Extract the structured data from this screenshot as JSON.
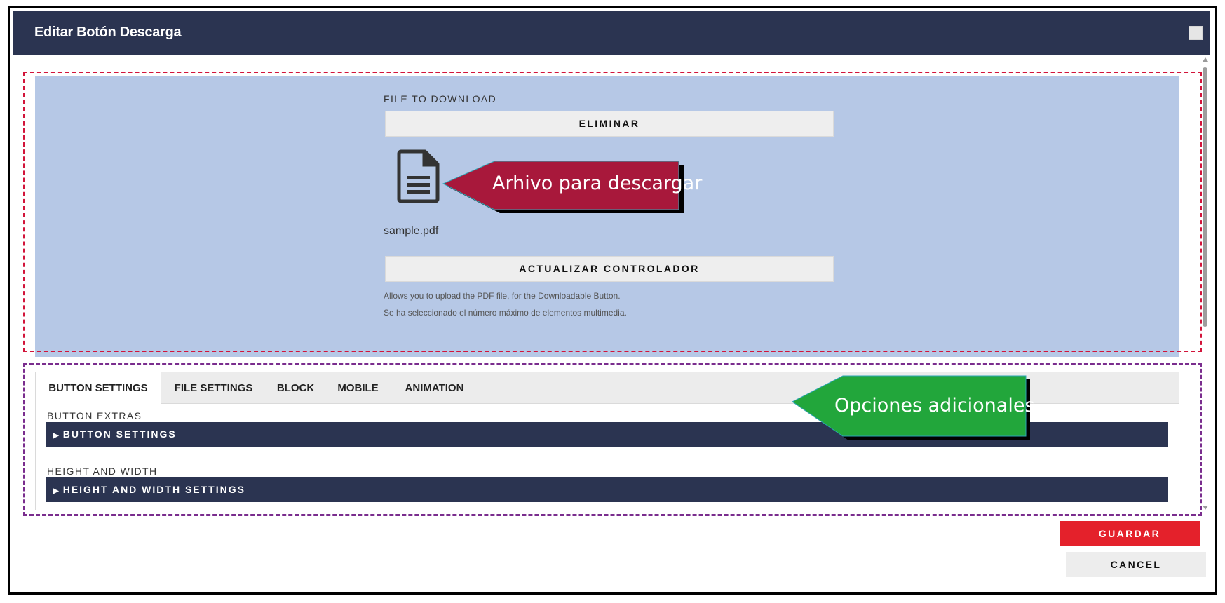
{
  "dialog": {
    "title": "Editar Botón Descarga"
  },
  "upload_panel": {
    "file_label": "FILE TO DOWNLOAD",
    "remove_button": "ELIMINAR",
    "file_icon": "file-document-icon",
    "file_name": "sample.pdf",
    "update_button": "ACTUALIZAR CONTROLADOR",
    "help_text_1": "Allows you to upload the PDF file, for the Downloadable Button.",
    "help_text_2": "Se ha seleccionado el número máximo de elementos multimedia."
  },
  "tabs": [
    {
      "label": "BUTTON SETTINGS",
      "active": true
    },
    {
      "label": "FILE SETTINGS",
      "active": false
    },
    {
      "label": "BLOCK",
      "active": false
    },
    {
      "label": "MOBILE",
      "active": false
    },
    {
      "label": "ANIMATION",
      "active": false
    }
  ],
  "sections": [
    {
      "label": "BUTTON EXTRAS",
      "accordion": "BUTTON SETTINGS"
    },
    {
      "label": "HEIGHT AND WIDTH",
      "accordion": "HEIGHT AND WIDTH SETTINGS"
    }
  ],
  "footer": {
    "save_button": "GUARDAR",
    "cancel_button": "CANCEL"
  },
  "annotations": {
    "file_callout": "Arhivo para descargar",
    "options_callout": "Opciones adicionales"
  },
  "colors": {
    "header": "#2b3451",
    "panel": "#b6c8e6",
    "save": "#e4212b",
    "callout_red": "#a8183b",
    "callout_green": "#22a63b",
    "dash_red": "#d2143a",
    "dash_purple": "#7a2d8e"
  }
}
